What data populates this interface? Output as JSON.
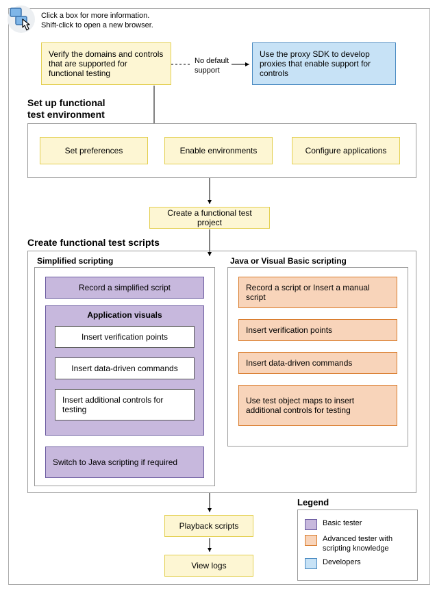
{
  "hint": {
    "line1": "Click a box for more information.",
    "line2": "Shift-click to open a new browser."
  },
  "top_row": {
    "verify": "Verify the domains and controls that are supported for functional testing",
    "no_default": "No default support",
    "proxy": "Use the proxy SDK to develop proxies that enable support for controls"
  },
  "setup": {
    "title_l1": "Set up functional",
    "title_l2": "test environment",
    "prefs": "Set preferences",
    "enable_env": "Enable environments",
    "config_apps": "Configure applications"
  },
  "create_project": "Create a functional test project",
  "scripts": {
    "title": "Create functional test scripts",
    "simplified": {
      "title": "Simplified scripting",
      "record": "Record a simplified script",
      "app_visuals": "Application visuals",
      "verify": "Insert verification points",
      "data_driven": "Insert data-driven commands",
      "additional": "Insert additional controls for testing",
      "switch": "Switch to Java scripting if required"
    },
    "java_vb": {
      "title": "Java or Visual Basic scripting",
      "record": "Record a script or Insert a manual script",
      "verify": "Insert verification points",
      "data_driven": "Insert data-driven commands",
      "obj_maps": "Use test object maps to insert additional controls for testing"
    }
  },
  "playback": "Playback scripts",
  "view_logs": "View logs",
  "legend": {
    "title": "Legend",
    "basic": "Basic tester",
    "advanced": "Advanced tester with scripting knowledge",
    "dev": "Developers"
  },
  "colors": {
    "yellow": "#fdf6d3",
    "blue": "#c7e2f6",
    "purple": "#c7b8dd",
    "orange": "#f8d4ba"
  }
}
